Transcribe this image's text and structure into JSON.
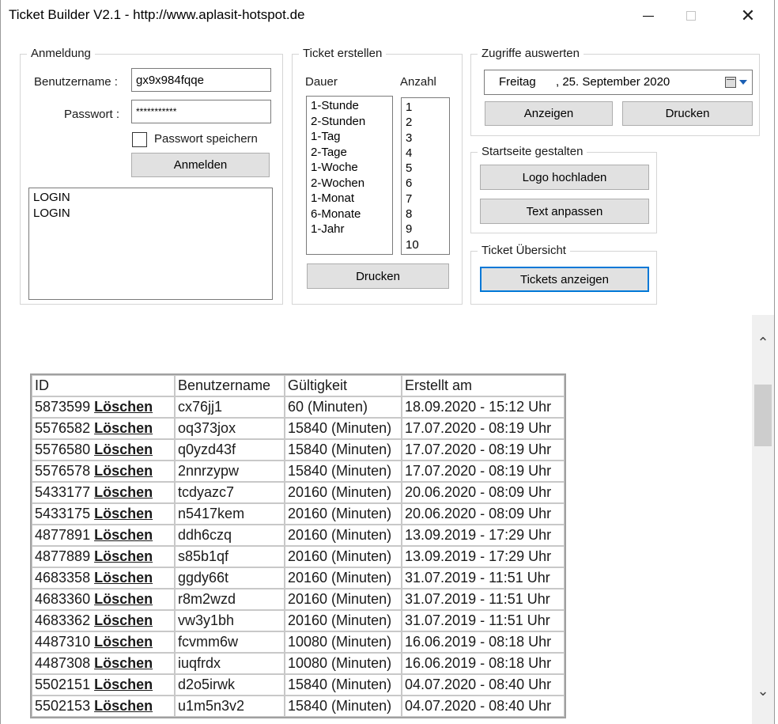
{
  "window": {
    "title": "Ticket Builder V2.1 - http://www.aplasit-hotspot.de"
  },
  "login": {
    "group_title": "Anmeldung",
    "username_label": "Benutzername :",
    "username_value": "gx9x984fqqe",
    "password_label": "Passwort :",
    "password_value": "***********",
    "remember_label": "Passwort speichern",
    "login_button": "Anmelden",
    "log_lines": [
      "LOGIN",
      "LOGIN"
    ]
  },
  "create": {
    "group_title": "Ticket erstellen",
    "duration_label": "Dauer",
    "count_label": "Anzahl",
    "durations": [
      "1-Stunde",
      "2-Stunden",
      "1-Tag",
      "2-Tage",
      "1-Woche",
      "2-Wochen",
      "1-Monat",
      "6-Monate",
      "1-Jahr"
    ],
    "counts": [
      "1",
      "2",
      "3",
      "4",
      "5",
      "6",
      "7",
      "8",
      "9",
      "10"
    ],
    "print_button": "Drucken"
  },
  "access": {
    "group_title": "Zugriffe auswerten",
    "date_day": "Freitag",
    "date_rest": ", 25. September 2020",
    "show_button": "Anzeigen",
    "print_button": "Drucken"
  },
  "start": {
    "group_title": "Startseite gestalten",
    "logo_button": "Logo hochladen",
    "text_button": "Text anpassen"
  },
  "overview": {
    "group_title": "Ticket Übersicht",
    "show_button": "Tickets anzeigen"
  },
  "table": {
    "headers": [
      "ID",
      "Benutzername",
      "Gültigkeit",
      "Erstellt am"
    ],
    "delete_label": "Löschen",
    "rows": [
      {
        "id": "5873599",
        "user": "cx76jj1",
        "valid": "60 (Minuten)",
        "created": "18.09.2020 - 15:12 Uhr"
      },
      {
        "id": "5576582",
        "user": "oq373jox",
        "valid": "15840 (Minuten)",
        "created": "17.07.2020 - 08:19 Uhr"
      },
      {
        "id": "5576580",
        "user": "q0yzd43f",
        "valid": "15840 (Minuten)",
        "created": "17.07.2020 - 08:19 Uhr"
      },
      {
        "id": "5576578",
        "user": "2nnrzypw",
        "valid": "15840 (Minuten)",
        "created": "17.07.2020 - 08:19 Uhr"
      },
      {
        "id": "5433177",
        "user": "tcdyazc7",
        "valid": "20160 (Minuten)",
        "created": "20.06.2020 - 08:09 Uhr"
      },
      {
        "id": "5433175",
        "user": "n5417kem",
        "valid": "20160 (Minuten)",
        "created": "20.06.2020 - 08:09 Uhr"
      },
      {
        "id": "4877891",
        "user": "ddh6czq",
        "valid": "20160 (Minuten)",
        "created": "13.09.2019 - 17:29 Uhr"
      },
      {
        "id": "4877889",
        "user": "s85b1qf",
        "valid": "20160 (Minuten)",
        "created": "13.09.2019 - 17:29 Uhr"
      },
      {
        "id": "4683358",
        "user": "ggdy66t",
        "valid": "20160 (Minuten)",
        "created": "31.07.2019 - 11:51 Uhr"
      },
      {
        "id": "4683360",
        "user": "r8m2wzd",
        "valid": "20160 (Minuten)",
        "created": "31.07.2019 - 11:51 Uhr"
      },
      {
        "id": "4683362",
        "user": "vw3y1bh",
        "valid": "20160 (Minuten)",
        "created": "31.07.2019 - 11:51 Uhr"
      },
      {
        "id": "4487310",
        "user": "fcvmm6w",
        "valid": "10080 (Minuten)",
        "created": "16.06.2019 - 08:18 Uhr"
      },
      {
        "id": "4487308",
        "user": "iuqfrdx",
        "valid": "10080 (Minuten)",
        "created": "16.06.2019 - 08:18 Uhr"
      },
      {
        "id": "5502151",
        "user": "d2o5irwk",
        "valid": "15840 (Minuten)",
        "created": "04.07.2020 - 08:40 Uhr"
      },
      {
        "id": "5502153",
        "user": "u1m5n3v2",
        "valid": "15840 (Minuten)",
        "created": "04.07.2020 - 08:40 Uhr"
      }
    ]
  }
}
